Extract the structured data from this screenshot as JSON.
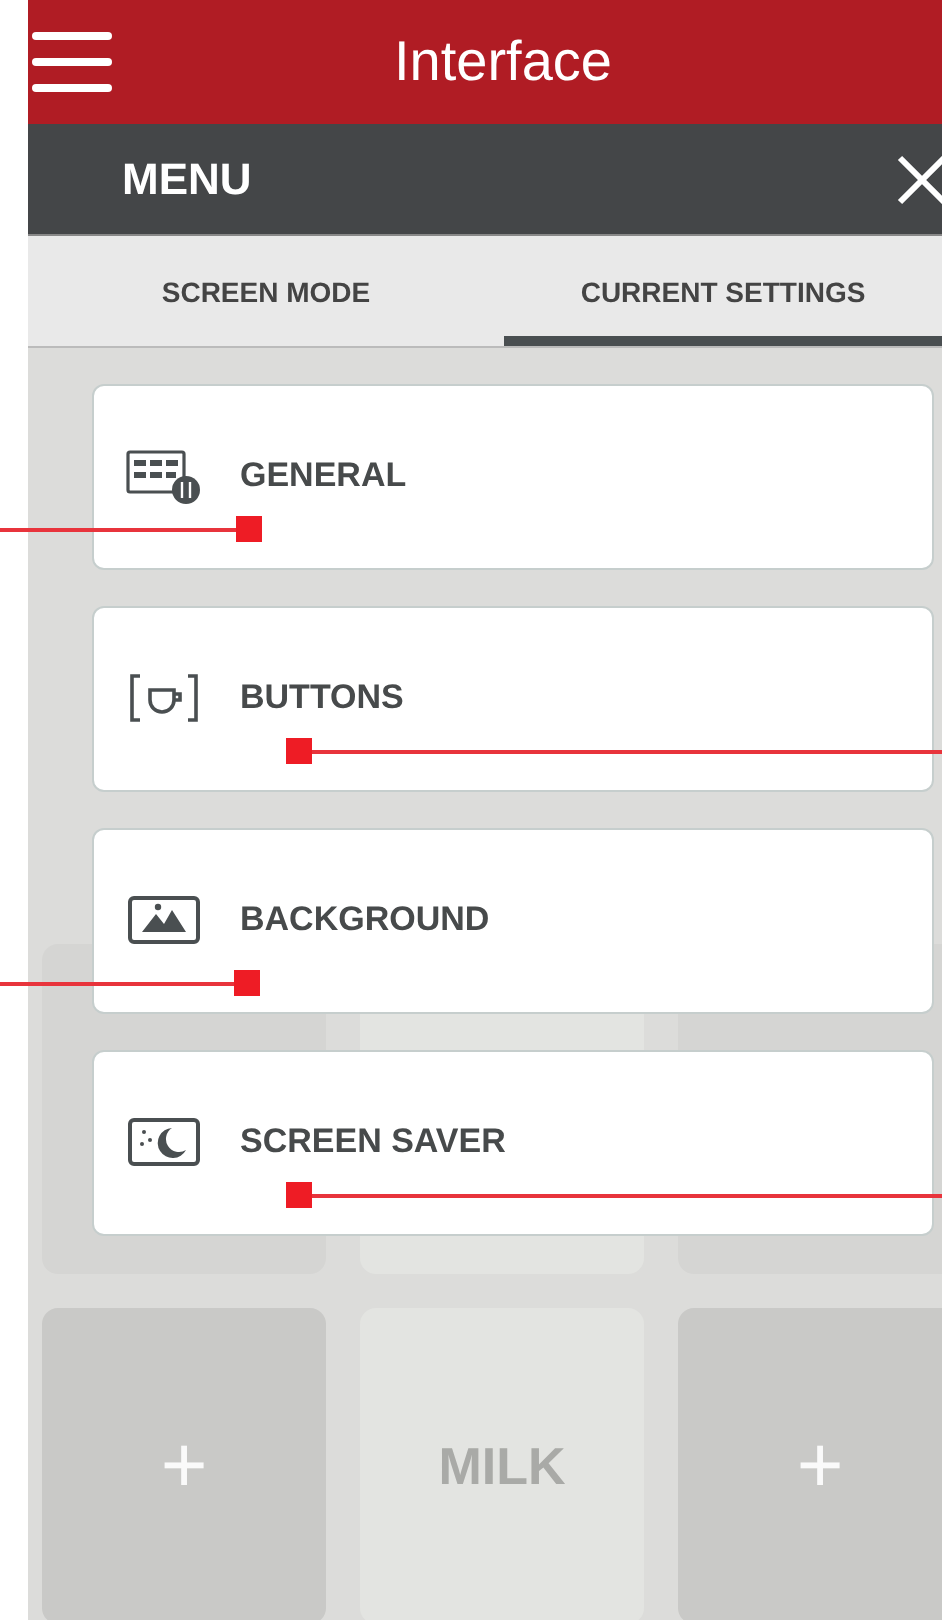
{
  "app_bar": {
    "title": "Interface"
  },
  "menu": {
    "title": "MENU"
  },
  "tabs": [
    {
      "label": "SCREEN MODE",
      "selected": false
    },
    {
      "label": "CURRENT SETTINGS",
      "selected": true
    }
  ],
  "settings": [
    {
      "label": "GENERAL",
      "kind": "general"
    },
    {
      "label": "BUTTONS",
      "kind": "buttons"
    },
    {
      "label": "BACKGROUND",
      "kind": "background"
    },
    {
      "label": "SCREEN SAVER",
      "kind": "screensaver"
    }
  ],
  "background_tiles": [
    {
      "label": "+",
      "kind": "add"
    },
    {
      "label": "MILK",
      "kind": "drink"
    },
    {
      "label": "+",
      "kind": "add"
    }
  ]
}
